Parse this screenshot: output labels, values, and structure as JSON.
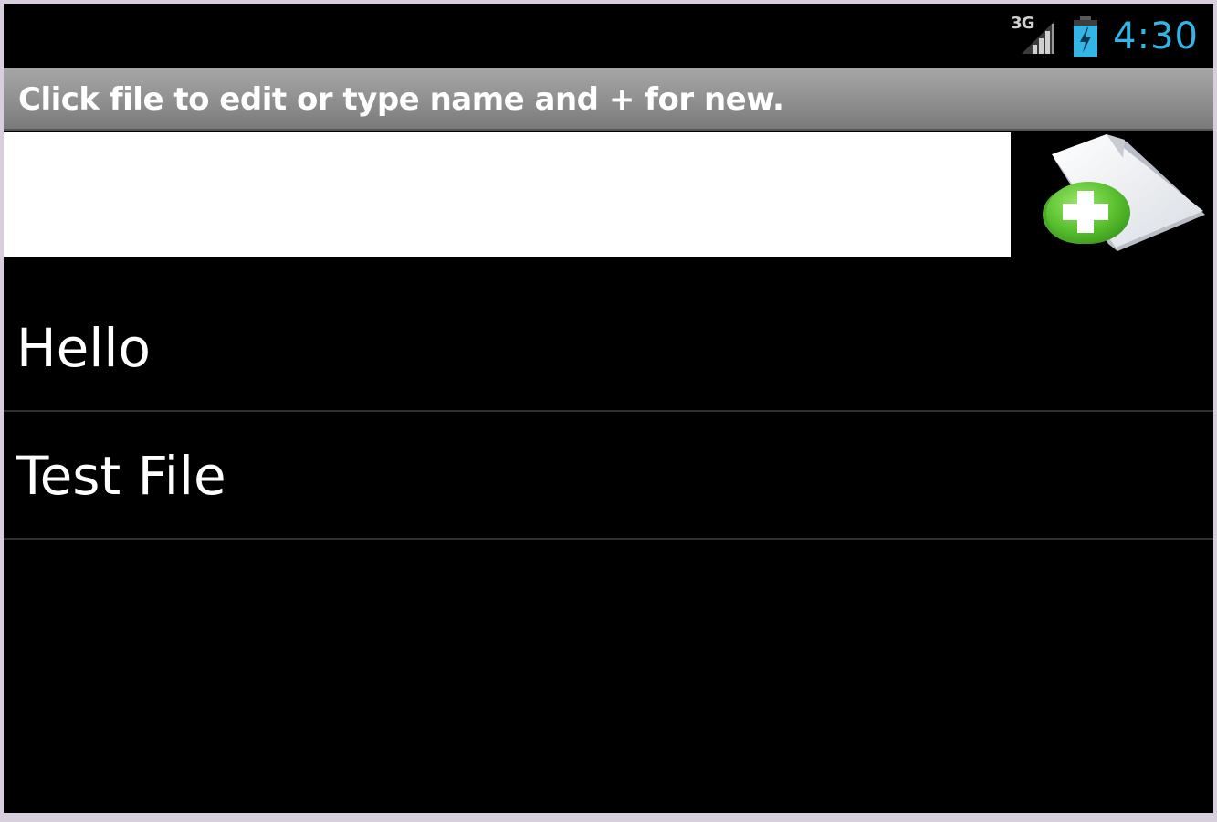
{
  "status_bar": {
    "network_type": "3G",
    "time": "4:30",
    "signal_icon": "signal-strength-icon",
    "battery_icon": "battery-charging-icon"
  },
  "title_bar": {
    "title": "Click file to edit or type name and + for new."
  },
  "new_file": {
    "input_value": "",
    "input_placeholder": "",
    "add_button_icon": "add-file-icon"
  },
  "files": [
    {
      "name": "Hello"
    },
    {
      "name": "Test File"
    }
  ],
  "colors": {
    "clock": "#33b5e5",
    "title_bar": "#8f8f8f",
    "background": "#000000",
    "add_icon_green": "#6fcf3a"
  }
}
